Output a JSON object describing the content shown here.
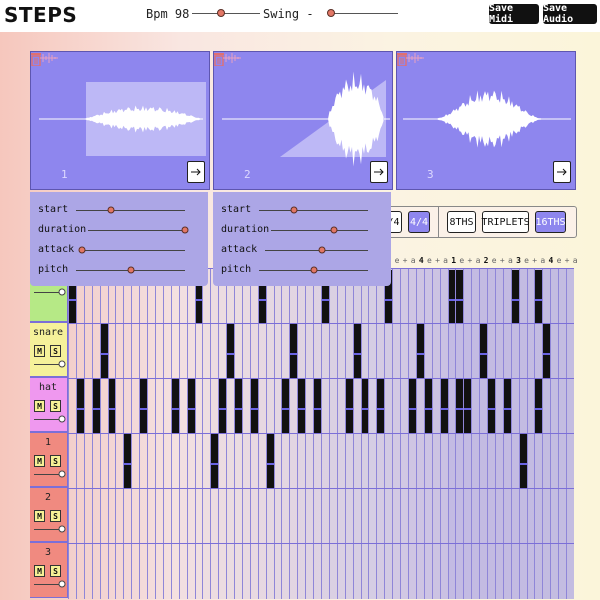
{
  "app": {
    "title": "STEPS"
  },
  "header": {
    "bpm_label": "Bpm 98",
    "swing_label": "Swing -",
    "save_midi": "Save Midi",
    "save_audio": "Save Audio",
    "bpm_level": 0.42,
    "swing_level": 0.02
  },
  "samples": [
    {
      "number": "1",
      "params": {
        "start": 0.32,
        "duration": 1.0,
        "attack": 0.0,
        "pitch": 0.5
      }
    },
    {
      "number": "2",
      "params": {
        "start": 0.32,
        "duration": 0.65,
        "attack": 0.55,
        "pitch": 0.5
      }
    },
    {
      "number": "3"
    }
  ],
  "params_labels": {
    "start": "start",
    "duration": "duration",
    "attack": "attack",
    "pitch": "pitch"
  },
  "time_signature": {
    "partial": "/4",
    "selected": "4/4"
  },
  "subdivisions": [
    {
      "label": "8THS",
      "selected": false
    },
    {
      "label": "TRIPLETS",
      "selected": false
    },
    {
      "label": "16THS",
      "selected": true
    }
  ],
  "beat_labels": [
    "e",
    "+",
    "a",
    "4",
    "e",
    "+",
    "a",
    "1",
    "e",
    "+",
    "a",
    "2",
    "e",
    "+",
    "a",
    "3",
    "e",
    "+",
    "a",
    "4",
    "e",
    "+",
    "a"
  ],
  "tracks": [
    {
      "name": "",
      "color": "#b6e986",
      "mute": "M",
      "solo": "S"
    },
    {
      "name": "snare",
      "color": "#f5f19a",
      "mute": "M",
      "solo": "S"
    },
    {
      "name": "hat",
      "color": "#ef98ef",
      "mute": "M",
      "solo": "S"
    },
    {
      "name": "1",
      "color": "#f08a80",
      "mute": "M",
      "solo": "S"
    },
    {
      "name": "2",
      "color": "#f08a80",
      "mute": "M",
      "solo": "S"
    },
    {
      "name": "3",
      "color": "#f08a80",
      "mute": "M",
      "solo": "S"
    }
  ]
}
